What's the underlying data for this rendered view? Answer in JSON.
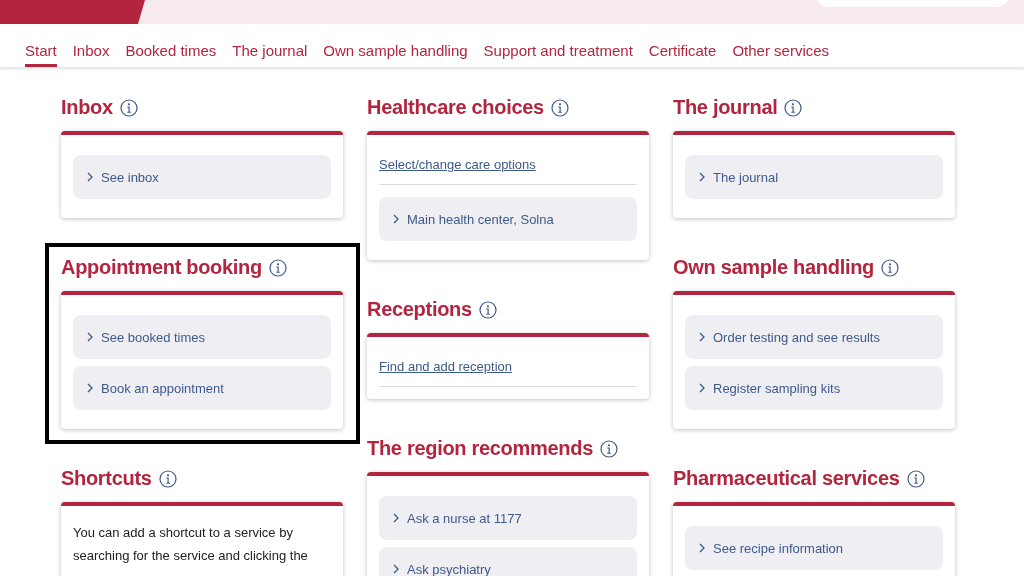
{
  "tabs": [
    {
      "label": "Start",
      "selected": true
    },
    {
      "label": "Inbox",
      "selected": false
    },
    {
      "label": "Booked times",
      "selected": false
    },
    {
      "label": "The journal",
      "selected": false
    },
    {
      "label": "Own sample handling",
      "selected": false
    },
    {
      "label": "Support and treatment",
      "selected": false
    },
    {
      "label": "Certificate",
      "selected": false
    },
    {
      "label": "Other services",
      "selected": false
    }
  ],
  "columns": [
    [
      {
        "title": "Inbox",
        "items": [
          {
            "kind": "button",
            "label": "See inbox"
          }
        ]
      },
      {
        "title": "Appointment booking",
        "highlighted": true,
        "items": [
          {
            "kind": "button",
            "label": "See booked times"
          },
          {
            "kind": "button",
            "label": "Book an appointment"
          }
        ]
      },
      {
        "title": "Shortcuts",
        "items": [
          {
            "kind": "text",
            "label": "You can add a shortcut to a service by searching for the service and clicking the"
          }
        ]
      }
    ],
    [
      {
        "title": "Healthcare choices",
        "items": [
          {
            "kind": "link",
            "label": "Select/change care options"
          },
          {
            "kind": "button",
            "label": "Main health center, Solna"
          }
        ]
      },
      {
        "title": "Receptions",
        "items": [
          {
            "kind": "link",
            "label": "Find and add reception"
          }
        ]
      },
      {
        "title": "The region recommends",
        "items": [
          {
            "kind": "button",
            "label": "Ask a nurse at 1177"
          },
          {
            "kind": "button",
            "label": "Ask psychiatry"
          }
        ]
      }
    ],
    [
      {
        "title": "The journal",
        "items": [
          {
            "kind": "button",
            "label": "The journal"
          }
        ]
      },
      {
        "title": "Own sample handling",
        "items": [
          {
            "kind": "button",
            "label": "Order testing and see results"
          },
          {
            "kind": "button",
            "label": "Register sampling kits"
          }
        ]
      },
      {
        "title": "Pharmaceutical services",
        "items": [
          {
            "kind": "button",
            "label": "See recipe information"
          }
        ]
      }
    ]
  ]
}
